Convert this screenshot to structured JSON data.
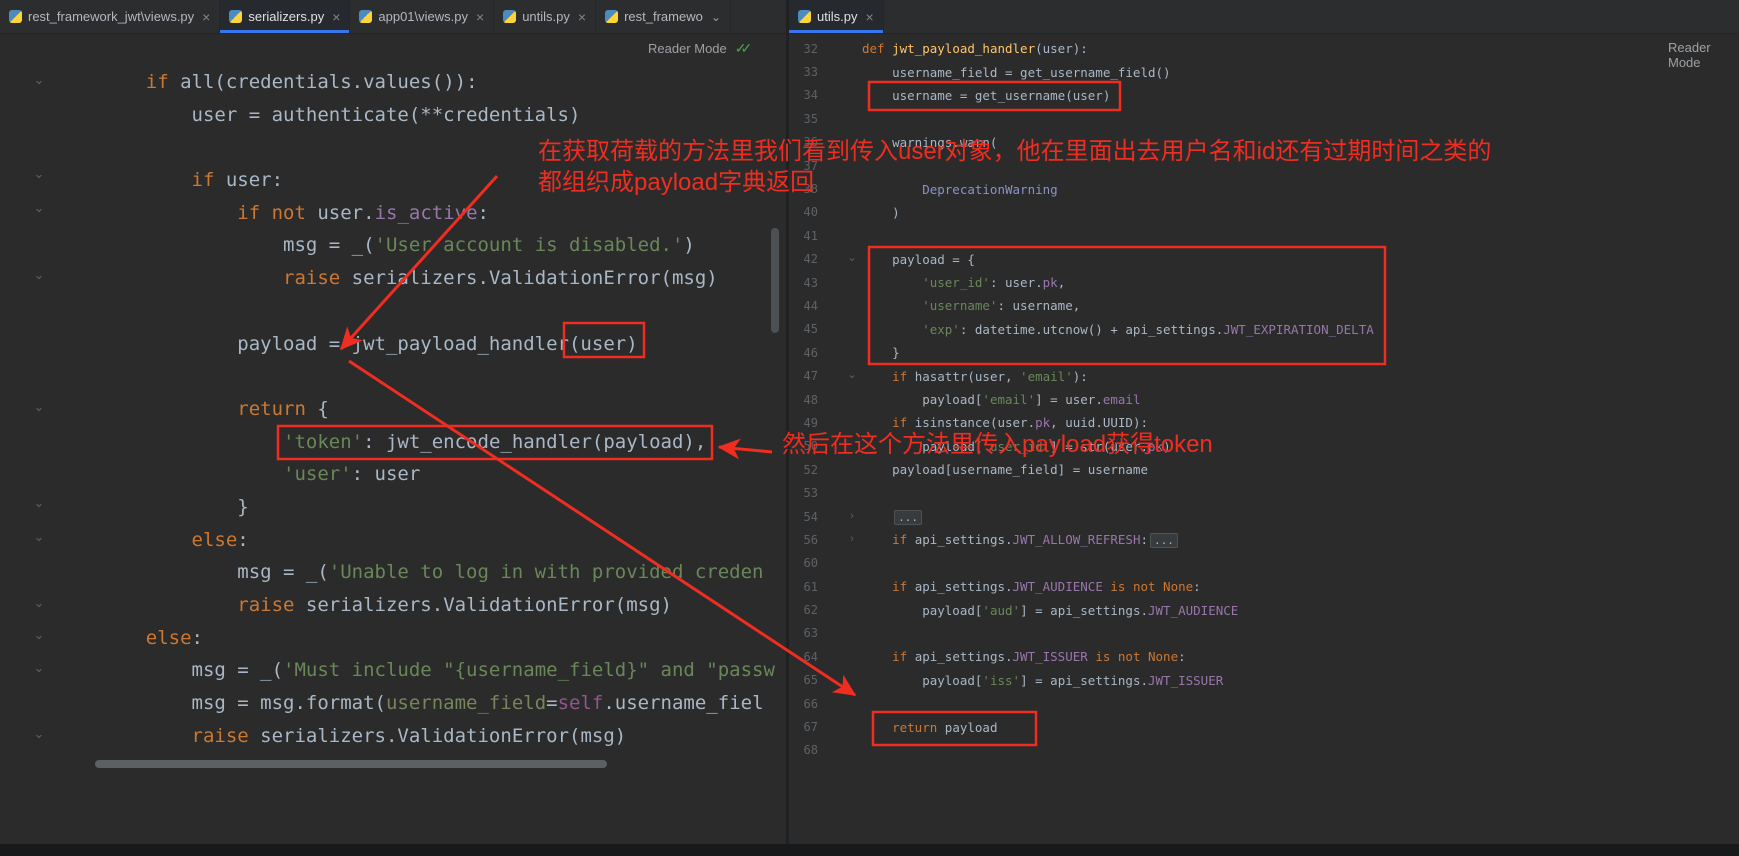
{
  "accent": {
    "red": "#ef2d20",
    "tab_underline": "#3876f0",
    "check_green": "#49a54d"
  },
  "tabs": {
    "close_glyph": "×",
    "overflow_chevron": "⌄",
    "left": [
      {
        "label": "rest_framework_jwt\\views.py",
        "active": false
      },
      {
        "label": "serializers.py",
        "active": true
      },
      {
        "label": "app01\\views.py",
        "active": false
      },
      {
        "label": "untils.py",
        "active": false
      },
      {
        "label": "rest_framewo",
        "active": false,
        "overflow": true
      }
    ],
    "right": [
      {
        "label": "utils.py",
        "active": true
      }
    ]
  },
  "left_pane": {
    "reader_mode_label": "Reader Mode",
    "reader_mode_check": "✓✓",
    "lines": [
      [
        [
          "d",
          "    "
        ],
        [
          "k",
          "if "
        ],
        [
          "d",
          "all(credentials.values()):"
        ]
      ],
      [
        [
          "d",
          "        user = authenticate(**credentials)"
        ]
      ],
      [],
      [
        [
          "d",
          "        "
        ],
        [
          "k",
          "if "
        ],
        [
          "d",
          "user:"
        ]
      ],
      [
        [
          "d",
          "            "
        ],
        [
          "k",
          "if not "
        ],
        [
          "d",
          "user."
        ],
        [
          "a",
          "is_active"
        ],
        [
          "d",
          ":"
        ]
      ],
      [
        [
          "d",
          "                msg = _("
        ],
        [
          "s",
          "'User account is disabled.'"
        ],
        [
          "d",
          ")"
        ]
      ],
      [
        [
          "d",
          "                "
        ],
        [
          "k",
          "raise "
        ],
        [
          "d",
          "serializers.ValidationError(msg)"
        ]
      ],
      [],
      [
        [
          "d",
          "            payload = jwt_payload_handler(user)"
        ]
      ],
      [],
      [
        [
          "d",
          "            "
        ],
        [
          "k",
          "return "
        ],
        [
          "d",
          "{"
        ]
      ],
      [
        [
          "d",
          "                "
        ],
        [
          "s",
          "'token'"
        ],
        [
          "d",
          ": jwt_encode_handler(payload),"
        ]
      ],
      [
        [
          "d",
          "                "
        ],
        [
          "s",
          "'user'"
        ],
        [
          "d",
          ": user"
        ]
      ],
      [
        [
          "d",
          "            }"
        ]
      ],
      [
        [
          "d",
          "        "
        ],
        [
          "k",
          "else"
        ],
        [
          "d",
          ":"
        ]
      ],
      [
        [
          "d",
          "            msg = _("
        ],
        [
          "s",
          "'Unable to log in with provided creden"
        ]
      ],
      [
        [
          "d",
          "            "
        ],
        [
          "k",
          "raise "
        ],
        [
          "d",
          "serializers.ValidationError(msg)"
        ]
      ],
      [
        [
          "d",
          "    "
        ],
        [
          "k",
          "else"
        ],
        [
          "d",
          ":"
        ]
      ],
      [
        [
          "d",
          "        msg = _("
        ],
        [
          "s",
          "'Must include \"{username_field}\" and \"passw"
        ]
      ],
      [
        [
          "d",
          "        msg = msg.format("
        ],
        [
          "kw",
          "username_field"
        ],
        [
          "d",
          "="
        ],
        [
          "se",
          "self"
        ],
        [
          "d",
          ".username_fiel"
        ]
      ],
      [
        [
          "d",
          "        "
        ],
        [
          "k",
          "raise "
        ],
        [
          "d",
          "serializers.ValidationError(msg)"
        ]
      ]
    ]
  },
  "right_pane": {
    "reader_mode_label": "Reader Mode",
    "lines": [
      {
        "n": "32",
        "t": [
          [
            "k",
            "def "
          ],
          [
            "f",
            "jwt_payload_handler"
          ],
          [
            "d",
            "(user):"
          ]
        ]
      },
      {
        "n": "33",
        "t": [
          [
            "d",
            "    username_field = get_username_field()"
          ]
        ]
      },
      {
        "n": "34",
        "t": [
          [
            "d",
            "    username = get_username(user)"
          ]
        ]
      },
      {
        "n": "35",
        "t": []
      },
      {
        "n": "36",
        "t": [
          [
            "d",
            "    warnings.warn("
          ]
        ]
      },
      {
        "n": "37",
        "t": []
      },
      {
        "n": "38",
        "t": [
          [
            "c",
            "        DeprecationWarning"
          ]
        ]
      },
      {
        "n": "40",
        "t": [
          [
            "d",
            "    )"
          ]
        ]
      },
      {
        "n": "41",
        "t": []
      },
      {
        "n": "42",
        "t": [
          [
            "d",
            "    payload = {"
          ]
        ]
      },
      {
        "n": "43",
        "t": [
          [
            "s",
            "        'user_id'"
          ],
          [
            "d",
            ": user."
          ],
          [
            "a",
            "pk"
          ],
          [
            "d",
            ","
          ]
        ]
      },
      {
        "n": "44",
        "t": [
          [
            "s",
            "        'username'"
          ],
          [
            "d",
            ": username,"
          ]
        ]
      },
      {
        "n": "45",
        "t": [
          [
            "s",
            "        'exp'"
          ],
          [
            "d",
            ": datetime.utcnow() + api_settings."
          ],
          [
            "a",
            "JWT_EXPIRATION_DELTA"
          ]
        ]
      },
      {
        "n": "46",
        "t": [
          [
            "d",
            "    }"
          ]
        ]
      },
      {
        "n": "47",
        "t": [
          [
            "k",
            "    if "
          ],
          [
            "d",
            "hasattr(user, "
          ],
          [
            "s",
            "'email'"
          ],
          [
            "d",
            "):"
          ]
        ]
      },
      {
        "n": "48",
        "t": [
          [
            "d",
            "        payload["
          ],
          [
            "s",
            "'email'"
          ],
          [
            "d",
            "] = user."
          ],
          [
            "a",
            "email"
          ]
        ]
      },
      {
        "n": "49",
        "t": [
          [
            "k",
            "    if "
          ],
          [
            "d",
            "isinstance(user."
          ],
          [
            "a",
            "pk"
          ],
          [
            "d",
            ", uuid.UUID):"
          ]
        ]
      },
      {
        "n": "50",
        "t": [
          [
            "d",
            "        payload["
          ],
          [
            "s",
            "'user_id'"
          ],
          [
            "d",
            "] = str(user."
          ],
          [
            "a",
            "pk"
          ],
          [
            "d",
            ")"
          ]
        ]
      },
      {
        "n": "52",
        "t": [
          [
            "d",
            "    payload[username_field] = username"
          ]
        ]
      },
      {
        "n": "53",
        "t": []
      },
      {
        "n": "54",
        "t": [
          [
            "d",
            "    "
          ],
          [
            "fold",
            "..."
          ]
        ]
      },
      {
        "n": "56",
        "t": [
          [
            "k",
            "    if "
          ],
          [
            "d",
            "api_settings."
          ],
          [
            "a",
            "JWT_ALLOW_REFRESH"
          ],
          [
            "d",
            ":"
          ],
          [
            "fold",
            "..."
          ]
        ]
      },
      {
        "n": "60",
        "t": []
      },
      {
        "n": "61",
        "t": [
          [
            "k",
            "    if "
          ],
          [
            "d",
            "api_settings."
          ],
          [
            "a",
            "JWT_AUDIENCE"
          ],
          [
            "k",
            " is not None"
          ],
          [
            "d",
            ":"
          ]
        ]
      },
      {
        "n": "62",
        "t": [
          [
            "d",
            "        payload["
          ],
          [
            "s",
            "'aud'"
          ],
          [
            "d",
            "] = api_settings."
          ],
          [
            "a",
            "JWT_AUDIENCE"
          ]
        ]
      },
      {
        "n": "63",
        "t": []
      },
      {
        "n": "64",
        "t": [
          [
            "k",
            "    if "
          ],
          [
            "d",
            "api_settings."
          ],
          [
            "a",
            "JWT_ISSUER"
          ],
          [
            "k",
            " is not None"
          ],
          [
            "d",
            ":"
          ]
        ]
      },
      {
        "n": "65",
        "t": [
          [
            "d",
            "        payload["
          ],
          [
            "s",
            "'iss'"
          ],
          [
            "d",
            "] = api_settings."
          ],
          [
            "a",
            "JWT_ISSUER"
          ]
        ]
      },
      {
        "n": "66",
        "t": []
      },
      {
        "n": "67",
        "t": [
          [
            "k",
            "    return "
          ],
          [
            "d",
            "payload"
          ]
        ]
      },
      {
        "n": "68",
        "t": []
      }
    ]
  },
  "annotations": {
    "note1_line1": "在获取荷载的方法里我们看到传入user对象，他在里面出去用户名和id还有过期时间之类的",
    "note1_line2": "都组织成payload字典返回",
    "note2": "然后在这个方法里传入payload获得token"
  }
}
